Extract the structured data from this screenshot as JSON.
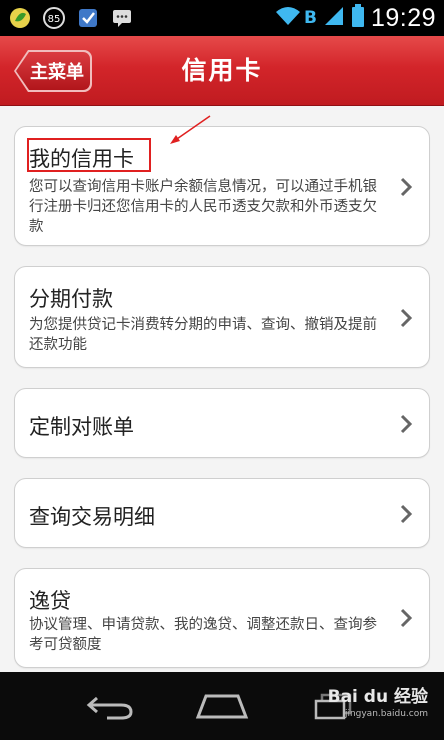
{
  "status_bar": {
    "time": "19:29",
    "network_letter": "B",
    "left_icons": [
      "leaf-app-icon",
      "circle-85-icon",
      "check-app-icon",
      "chat-app-icon"
    ],
    "circle_badge": "85"
  },
  "header": {
    "back_label": "主菜单",
    "title": "信用卡"
  },
  "menu": [
    {
      "title": "我的信用卡",
      "desc": "您可以查询信用卡账户余额信息情况，可以通过手机银行注册卡归还您信用卡的人民币透支欠款和外币透支欠款"
    },
    {
      "title": "分期付款",
      "desc": "为您提供贷记卡消费转分期的申请、查询、撤销及提前还款功能"
    },
    {
      "title": "定制对账单",
      "desc": ""
    },
    {
      "title": "查询交易明细",
      "desc": ""
    },
    {
      "title": "逸贷",
      "desc": "协议管理、申请贷款、我的逸贷、调整还款日、查询参考可贷额度"
    }
  ],
  "watermark": {
    "main": "Bai du 经验",
    "sub": "jingyan.baidu.com"
  },
  "colors": {
    "header_red": "#d3252a",
    "annotation_red": "#e02020",
    "content_bg": "#f4f4f4",
    "wifi_blue": "#3fb8f0"
  }
}
